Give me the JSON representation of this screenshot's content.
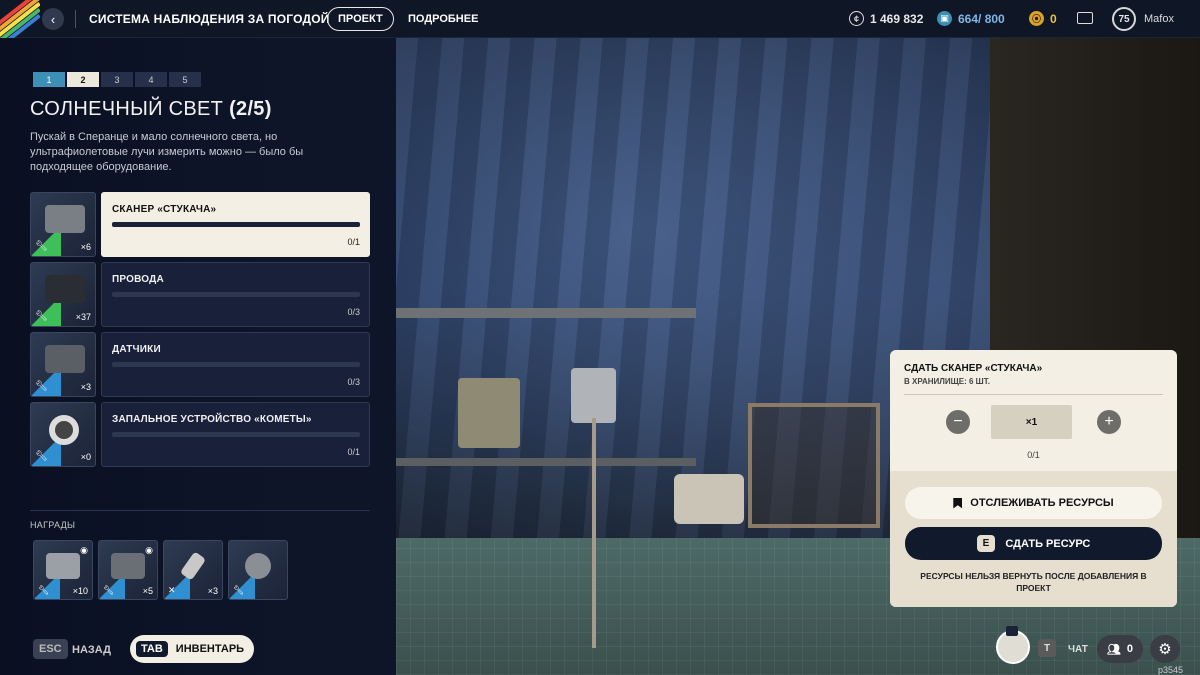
{
  "topbar": {
    "title": "СИСТЕМА НАБЛЮДЕНИЯ ЗА ПОГОДОЙ",
    "tabs": [
      {
        "label": "ПРОЕКТ",
        "active": true
      },
      {
        "label": "ПОДРОБНЕЕ",
        "active": false
      }
    ],
    "coins": "1 469 832",
    "storage": "664/ 800",
    "tokens": "0",
    "level": "75",
    "username": "Mafox"
  },
  "steps": [
    {
      "label": "1",
      "state": "done"
    },
    {
      "label": "2",
      "state": "current"
    },
    {
      "label": "3",
      "state": "todo"
    },
    {
      "label": "4",
      "state": "todo"
    },
    {
      "label": "5",
      "state": "todo"
    }
  ],
  "quest": {
    "title": "СОЛНЕЧНЫЙ СВЕТ",
    "count": "(2/5)",
    "description": "Пускай в Сперанце и мало солнечного света, но ультрафиолетовые лучи измерить можно — было бы подходящее оборудование."
  },
  "items": [
    {
      "name": "СКАНЕР «СТУКАЧА»",
      "owned": "×6",
      "progress": "0/1",
      "fraction": 0,
      "active": true,
      "rarity_color": "#3fbf5a",
      "pic_color": "#7a7f85"
    },
    {
      "name": "ПРОВОДА",
      "owned": "×37",
      "progress": "0/3",
      "fraction": 0,
      "active": false,
      "rarity_color": "#3fbf5a",
      "pic_color": "#2a2d33"
    },
    {
      "name": "ДАТЧИКИ",
      "owned": "×3",
      "progress": "0/3",
      "fraction": 0,
      "active": false,
      "rarity_color": "#2f8fd0",
      "pic_color": "#5a5f66"
    },
    {
      "name": "ЗАПАЛЬНОЕ УСТРОЙСТВО «КОМЕТЫ»",
      "owned": "×0",
      "progress": "0/1",
      "fraction": 0,
      "active": false,
      "rarity_color": "#2f8fd0",
      "pic_color": "#d8d8d8"
    }
  ],
  "rewards": {
    "label": "НАГРАДЫ",
    "items": [
      {
        "qty": "×10",
        "eye": true,
        "pic_color": "#9aa0a6",
        "icon": "wrench-icon"
      },
      {
        "qty": "×5",
        "eye": true,
        "pic_color": "#6a6f75",
        "icon": "wrench-icon"
      },
      {
        "qty": "×3",
        "eye": false,
        "pic_color": "#c8c8c8",
        "icon": "crossed-tools-icon"
      },
      {
        "qty": "",
        "eye": false,
        "pic_color": "#8a8f95",
        "icon": "wrench-icon"
      }
    ]
  },
  "bottom": {
    "esc_key": "ESC",
    "back_label": "НАЗАД",
    "tab_key": "TAB",
    "inventory_label": "ИНВЕНТАРЬ"
  },
  "submit_panel": {
    "title": "СДАТЬ СКАНЕР «СТУКАЧА»",
    "storage": "В ХРАНИЛИЩЕ: 6 ШТ.",
    "quantity": "×1",
    "progress": "0/1",
    "track_label": "ОТСЛЕЖИВАТЬ РЕСУРСЫ",
    "give_key": "E",
    "give_label": "СДАТЬ РЕСУРС",
    "warning": "РЕСУРСЫ НЕЛЬЗЯ ВЕРНУТЬ ПОСЛЕ ДОБАВЛЕНИЯ В ПРОЕКТ"
  },
  "footer_right": {
    "chat_key": "T",
    "chat_label": "ЧАТ",
    "friends_count": "0",
    "build_id": "p3545"
  },
  "colors": {
    "accent": "#f3efe4",
    "dark": "#111a2c",
    "step_done": "#3d8fb5"
  }
}
